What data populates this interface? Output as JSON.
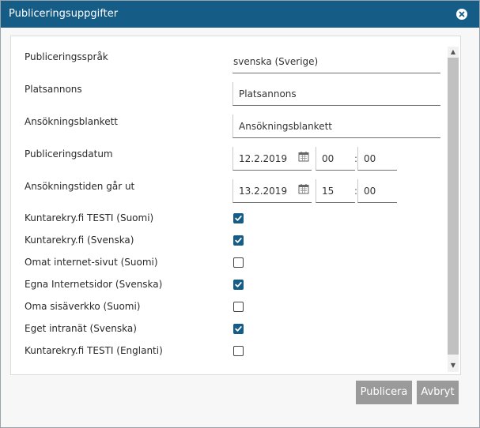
{
  "dialog": {
    "title": "Publiceringsuppgifter",
    "close_icon": "close-icon"
  },
  "form": {
    "language": {
      "label": "Publiceringsspråk",
      "value": "svenska (Sverige)"
    },
    "job_ad": {
      "label": "Platsannons",
      "value": "Platsannons"
    },
    "application_form": {
      "label": "Ansökningsblankett",
      "value": "Ansökningsblankett"
    },
    "publish_date": {
      "label": "Publiceringsdatum",
      "date": "12.2.2019",
      "hour": "00",
      "minute": "00"
    },
    "deadline": {
      "label": "Ansökningstiden går ut",
      "date": "13.2.2019",
      "hour": "15",
      "minute": "00"
    },
    "time_separator": ":",
    "channels": [
      {
        "label": "Kuntarekry.fi TESTI (Suomi)",
        "checked": true
      },
      {
        "label": "Kuntarekry.fi (Svenska)",
        "checked": true
      },
      {
        "label": "Omat internet-sivut (Suomi)",
        "checked": false
      },
      {
        "label": "Egna Internetsidor (Svenska)",
        "checked": true
      },
      {
        "label": "Oma sisäverkko (Suomi)",
        "checked": false
      },
      {
        "label": "Eget intranät (Svenska)",
        "checked": true
      },
      {
        "label": "Kuntarekry.fi TESTI (Englanti)",
        "checked": false
      }
    ]
  },
  "buttons": {
    "publish": "Publicera",
    "cancel": "Avbryt"
  },
  "colors": {
    "titlebar": "#155c86",
    "checkbox_checked": "#155c86",
    "button": "#9a9a9a"
  }
}
